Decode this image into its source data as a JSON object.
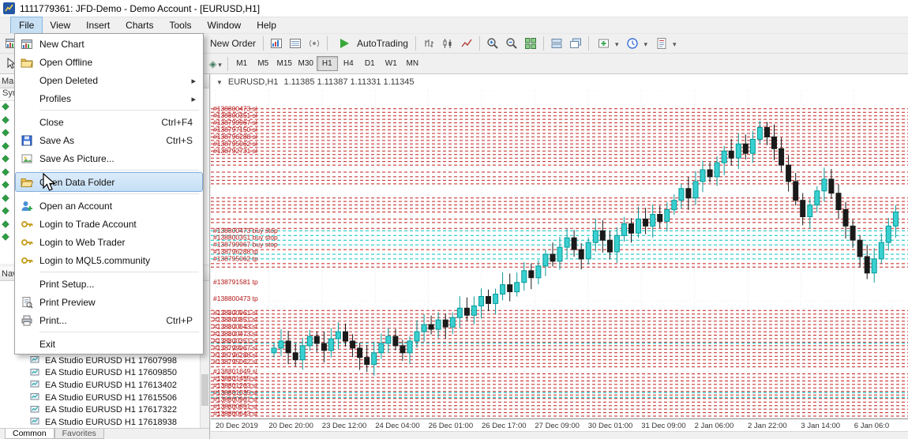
{
  "window": {
    "title": "1111779361: JFD-Demo - Demo Account - [EURUSD,H1]"
  },
  "menubar": {
    "items": [
      "File",
      "View",
      "Insert",
      "Charts",
      "Tools",
      "Window",
      "Help"
    ],
    "active": "File"
  },
  "file_menu": {
    "items": [
      {
        "label": "New Chart",
        "icon": "new-chart-icon"
      },
      {
        "label": "Open Offline",
        "icon": "folder-icon"
      },
      {
        "label": "Open Deleted",
        "submenu": true
      },
      {
        "label": "Profiles",
        "submenu": true
      },
      {
        "sep": true
      },
      {
        "label": "Close",
        "shortcut": "Ctrl+F4"
      },
      {
        "label": "Save As",
        "shortcut": "Ctrl+S",
        "icon": "floppy-icon"
      },
      {
        "label": "Save As Picture...",
        "icon": "picture-icon"
      },
      {
        "sep": true
      },
      {
        "label": "Open Data Folder",
        "icon": "open-folder-icon",
        "highlighted": true
      },
      {
        "sep": true
      },
      {
        "label": "Open an Account",
        "icon": "add-account-icon"
      },
      {
        "label": "Login to Trade Account",
        "icon": "key-icon"
      },
      {
        "label": "Login to Web Trader",
        "icon": "key-icon"
      },
      {
        "label": "Login to MQL5.community",
        "icon": "key-icon"
      },
      {
        "sep": true
      },
      {
        "label": "Print Setup..."
      },
      {
        "label": "Print Preview",
        "icon": "page-preview-icon"
      },
      {
        "label": "Print...",
        "shortcut": "Ctrl+P",
        "icon": "printer-icon"
      },
      {
        "sep": true
      },
      {
        "label": "Exit"
      }
    ]
  },
  "toolbar_main": {
    "items": [
      {
        "type": "button",
        "name": "new-order-button",
        "icon": "new-order-icon",
        "label": "New Order"
      },
      {
        "type": "sep"
      },
      {
        "type": "icon",
        "name": "market-watch-icon"
      },
      {
        "type": "icon",
        "name": "data-window-icon"
      },
      {
        "type": "icon",
        "name": "signals-icon"
      },
      {
        "type": "sep"
      },
      {
        "type": "button",
        "name": "autotrading-button",
        "icon": "autotrading-play-icon",
        "label": "AutoTrading"
      },
      {
        "type": "sep"
      },
      {
        "type": "icon",
        "name": "bar-chart-icon"
      },
      {
        "type": "icon",
        "name": "candlestick-chart-icon"
      },
      {
        "type": "icon",
        "name": "line-chart-icon"
      },
      {
        "type": "sep"
      },
      {
        "type": "icon",
        "name": "zoom-in-icon"
      },
      {
        "type": "icon",
        "name": "zoom-out-icon"
      },
      {
        "type": "icon",
        "name": "tile-windows-icon"
      },
      {
        "type": "sep"
      },
      {
        "type": "icon",
        "name": "arrange-windows-icon"
      },
      {
        "type": "icon",
        "name": "cascade-windows-icon"
      },
      {
        "type": "sep"
      },
      {
        "type": "dropdown",
        "name": "indicators-dropdown"
      },
      {
        "type": "dropdown",
        "name": "periods-dropdown"
      },
      {
        "type": "dropdown",
        "name": "templates-dropdown"
      }
    ]
  },
  "toolbar_line": {
    "timeframes": [
      "M1",
      "M5",
      "M15",
      "M30",
      "H1",
      "H4",
      "D1",
      "W1",
      "MN"
    ],
    "active_timeframe": "H1"
  },
  "left_panel": {
    "market_watch_title": "Market Watch",
    "symbol_column": "Symbol",
    "symbol_rows": 11,
    "navigator_title": "Navigator",
    "items": [
      "EA Studio EURUSD H1 17607998",
      "EA Studio EURUSD H1 17609850",
      "EA Studio EURUSD H1 17613402",
      "EA Studio EURUSD H1 17615506",
      "EA Studio EURUSD H1 17617322",
      "EA Studio EURUSD H1 17618938"
    ],
    "tabs": [
      "Common",
      "Favorites"
    ],
    "active_tab": "Common"
  },
  "colors": {
    "chart_red": "#c22020",
    "chart_aqua": "#00c2c2",
    "bull_fill": "#39d0d0",
    "bull_stroke": "#089a9a",
    "bear": "#1a1a1a",
    "order_label": "#b31212",
    "autotrading_green": "#38a838"
  },
  "chart": {
    "type": "candlestick",
    "symbol": "EURUSD,H1",
    "quotes": "1.11385 1.11387 1.11331 1.11345",
    "price_range": {
      "min": 1.1055,
      "max": 1.1195
    },
    "first_open": 1.1083,
    "closes": [
      1.1085,
      1.1088,
      1.1083,
      1.108,
      1.1086,
      1.109,
      1.1087,
      1.1084,
      1.1089,
      1.1092,
      1.1088,
      1.1085,
      1.1081,
      1.1078,
      1.1083,
      1.1087,
      1.109,
      1.1086,
      1.1083,
      1.1088,
      1.1092,
      1.1095,
      1.1093,
      1.1097,
      1.1094,
      1.1098,
      1.1102,
      1.1099,
      1.1103,
      1.1107,
      1.1104,
      1.1108,
      1.1112,
      1.1109,
      1.1113,
      1.1118,
      1.1115,
      1.112,
      1.1125,
      1.1122,
      1.1128,
      1.1132,
      1.1127,
      1.1123,
      1.113,
      1.1135,
      1.1131,
      1.1126,
      1.1133,
      1.1138,
      1.1134,
      1.114,
      1.1137,
      1.1142,
      1.1139,
      1.1144,
      1.1148,
      1.1153,
      1.1149,
      1.1156,
      1.1161,
      1.1158,
      1.1164,
      1.1169,
      1.1166,
      1.1172,
      1.1168,
      1.1174,
      1.1179,
      1.1175,
      1.117,
      1.1163,
      1.1156,
      1.1148,
      1.1141,
      1.1146,
      1.1152,
      1.1157,
      1.1151,
      1.1144,
      1.1137,
      1.1131,
      1.1124,
      1.1117,
      1.1123,
      1.113,
      1.1137,
      1.1143
    ],
    "red_lines": [
      1.1187,
      1.11855,
      1.1184,
      1.11825,
      1.1181,
      1.11795,
      1.1178,
      1.11765,
      1.1175,
      1.11735,
      1.1172,
      1.11705,
      1.1169,
      1.11675,
      1.1166,
      1.11645,
      1.1163,
      1.116,
      1.1158,
      1.11565,
      1.1155,
      1.1149,
      1.11475,
      1.1146,
      1.11445,
      1.1143,
      1.114,
      1.11385,
      1.1136,
      1.1127,
      1.1121,
      1.11195,
      1.1101,
      1.10995,
      1.1098,
      1.10965,
      1.1095,
      1.10935,
      1.1092,
      1.10905,
      1.1089,
      1.10875,
      1.1086,
      1.10845,
      1.1083,
      1.10815,
      1.108,
      1.10785,
      1.1077,
      1.1074,
      1.10725,
      1.1071,
      1.10695,
      1.1068,
      1.10665,
      1.1065,
      1.10635,
      1.1062,
      1.10605,
      1.1059,
      1.10575,
      1.1056
    ],
    "aqua_lines": [
      1.1135,
      1.1133,
      1.1131,
      1.1129,
      1.1125,
      1.1123,
      1.1087,
      1.1066,
      1.1064
    ],
    "order_labels": [
      {
        "text": "#138800473 sl",
        "price": 1.1187
      },
      {
        "text": "#138800351 sl",
        "price": 1.1184
      },
      {
        "text": "#138799967 sl",
        "price": 1.1181
      },
      {
        "text": "#138797150 sl",
        "price": 1.1178
      },
      {
        "text": "#138796288 sl",
        "price": 1.1175
      },
      {
        "text": "#138795062 sl",
        "price": 1.1172
      },
      {
        "text": "#138792731 sl",
        "price": 1.1169
      },
      {
        "text": "#138800473 buy stop",
        "price": 1.1135
      },
      {
        "text": "#138800351 buy stop",
        "price": 1.1132
      },
      {
        "text": "#138799967 buy stop",
        "price": 1.1129
      },
      {
        "text": "#138796288 tp",
        "price": 1.1126
      },
      {
        "text": "#138795062 tp",
        "price": 1.1123
      },
      {
        "text": "#138791581 tp",
        "price": 1.1113
      },
      {
        "text": "#138800473 tp",
        "price": 1.1106
      },
      {
        "text": "#138800961 sl",
        "price": 1.11
      },
      {
        "text": "#138800851 sl",
        "price": 1.1097
      },
      {
        "text": "#138800643 sl",
        "price": 1.1094
      },
      {
        "text": "#138800473 sl",
        "price": 1.1091
      },
      {
        "text": "#138800351 sl",
        "price": 1.1088
      },
      {
        "text": "#138799967 sl",
        "price": 1.1085
      },
      {
        "text": "#138796288 sl",
        "price": 1.1082
      },
      {
        "text": "#138795062 sl",
        "price": 1.1079
      },
      {
        "text": "#138801649 sl",
        "price": 1.1075
      },
      {
        "text": "#138801455 sl",
        "price": 1.1072
      },
      {
        "text": "#138801263 sl",
        "price": 1.1069
      },
      {
        "text": "#138801035 sl",
        "price": 1.1066
      },
      {
        "text": "#138800961 sl",
        "price": 1.1063
      },
      {
        "text": "#138800851 sl",
        "price": 1.106
      },
      {
        "text": "#138800643 sl",
        "price": 1.1057
      }
    ],
    "time_labels": [
      "20 Dec 2019",
      "20 Dec 20:00",
      "23 Dec 12:00",
      "24 Dec 04:00",
      "26 Dec 01:00",
      "26 Dec 17:00",
      "27 Dec 09:00",
      "30 Dec 01:00",
      "31 Dec 09:00",
      "2 Jan 06:00",
      "2 Jan 22:00",
      "3 Jan 14:00",
      "6 Jan 06:0"
    ]
  }
}
